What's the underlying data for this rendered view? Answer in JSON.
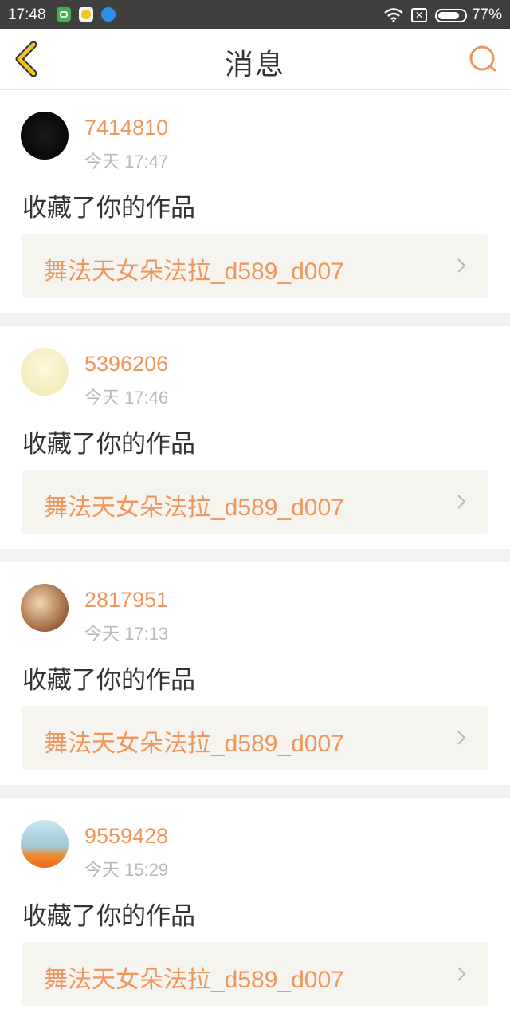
{
  "status_bar": {
    "time": "17:48",
    "battery": "77%",
    "sim_icon": "✕"
  },
  "header": {
    "title": "消息"
  },
  "messages": [
    {
      "username": "7414810",
      "time": "今天 17:47",
      "action": "收藏了你的作品",
      "work_title": "舞法天女朵法拉_d589_d007"
    },
    {
      "username": "5396206",
      "time": "今天 17:46",
      "action": "收藏了你的作品",
      "work_title": "舞法天女朵法拉_d589_d007"
    },
    {
      "username": "2817951",
      "time": "今天 17:13",
      "action": "收藏了你的作品",
      "work_title": "舞法天女朵法拉_d589_d007"
    },
    {
      "username": "9559428",
      "time": "今天 15:29",
      "action": "收藏了你的作品",
      "work_title": "舞法天女朵法拉_d589_d007"
    }
  ],
  "colors": {
    "accent": "#f0955c",
    "back_icon": "#f2c423",
    "gap": "#f2f2f2",
    "card_box": "#f5f4ee"
  }
}
